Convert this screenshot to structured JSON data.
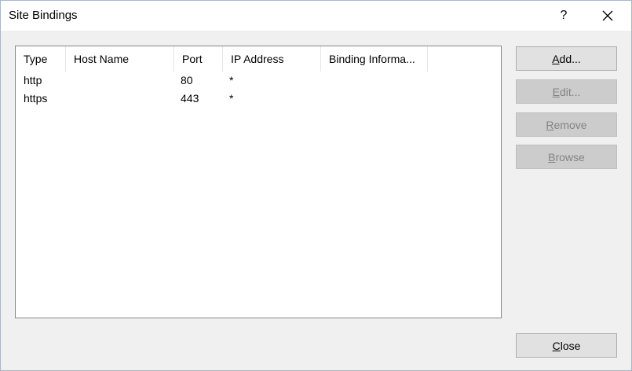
{
  "window": {
    "title": "Site Bindings",
    "help_glyph": "?"
  },
  "table": {
    "columns": [
      "Type",
      "Host Name",
      "Port",
      "IP Address",
      "Binding Informa..."
    ],
    "rows": [
      {
        "type": "http",
        "host_name": "",
        "port": "80",
        "ip_address": "*",
        "binding_info": ""
      },
      {
        "type": "https",
        "host_name": "",
        "port": "443",
        "ip_address": "*",
        "binding_info": ""
      }
    ]
  },
  "buttons": {
    "add": {
      "label": "Add...",
      "mnemonic": "A",
      "rest": "dd...",
      "enabled": true
    },
    "edit": {
      "label": "Edit...",
      "mnemonic": "E",
      "rest": "dit...",
      "enabled": false
    },
    "remove": {
      "label": "Remove",
      "mnemonic": "R",
      "rest": "emove",
      "enabled": false
    },
    "browse": {
      "label": "Browse",
      "mnemonic": "B",
      "rest": "rowse",
      "enabled": false
    },
    "close": {
      "label": "Close",
      "mnemonic": "C",
      "rest": "lose",
      "enabled": true
    }
  },
  "icons": {
    "help": "question-mark-icon",
    "close": "close-x-icon"
  }
}
